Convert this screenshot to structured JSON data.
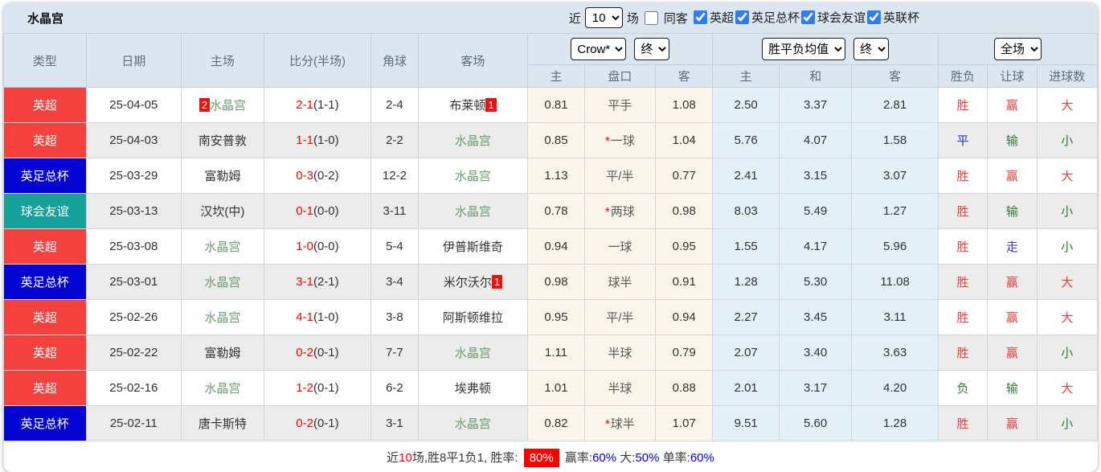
{
  "page": {
    "title": "水晶宫",
    "filters": {
      "near_label": "近",
      "near_value": "10",
      "games_label": "场",
      "same_opponent_label": "同客",
      "leagues": [
        {
          "label": "英超",
          "checked": true
        },
        {
          "label": "英足总杯",
          "checked": true
        },
        {
          "label": "球会友谊",
          "checked": true
        },
        {
          "label": "英联杯",
          "checked": true
        }
      ]
    }
  },
  "table": {
    "headers": {
      "main": [
        "类型",
        "日期",
        "主场",
        "比分(半场)",
        "角球",
        "客场"
      ],
      "sub": [
        "主",
        "盘口",
        "客",
        "主",
        "和",
        "客",
        "胜负",
        "让球",
        "进球数"
      ]
    },
    "selectors": {
      "bookmaker": "Crow*",
      "handicap_time": "终",
      "avg_label": "胜平负均值",
      "avg_time": "终",
      "period": "全场"
    },
    "league_colors": {
      "英超": "#f5413d",
      "英足总杯": "#0503d1",
      "球会友谊": "#16a09a"
    },
    "rows": [
      {
        "league": {
          "label": "英超",
          "color": "#f5413d"
        },
        "date": "25-04-05",
        "home": {
          "name": "水晶宫",
          "subject": true,
          "badge": "2"
        },
        "score": {
          "full": "2-1",
          "half": "(1-1)"
        },
        "corners": "2-4",
        "away": {
          "name": "布莱顿",
          "subject": false,
          "badge": "1"
        },
        "handicap": {
          "home": "0.81",
          "star": false,
          "line": "平手",
          "away": "1.08"
        },
        "avg": {
          "home": "2.50",
          "draw": "3.37",
          "away": "2.81"
        },
        "result": {
          "label": "胜",
          "tone": "red"
        },
        "let": {
          "label": "赢",
          "tone": "red"
        },
        "goals": {
          "label": "大",
          "tone": "red"
        }
      },
      {
        "league": {
          "label": "英超",
          "color": "#f5413d"
        },
        "date": "25-04-03",
        "home": {
          "name": "南安普敦",
          "subject": false,
          "badge": ""
        },
        "score": {
          "full": "1-1",
          "half": "(1-0)"
        },
        "corners": "2-2",
        "away": {
          "name": "水晶宫",
          "subject": true,
          "badge": ""
        },
        "handicap": {
          "home": "0.85",
          "star": true,
          "line": "一球",
          "away": "1.04"
        },
        "avg": {
          "home": "5.76",
          "draw": "4.07",
          "away": "1.58"
        },
        "result": {
          "label": "平",
          "tone": "blue"
        },
        "let": {
          "label": "输",
          "tone": "green"
        },
        "goals": {
          "label": "小",
          "tone": "green"
        }
      },
      {
        "league": {
          "label": "英足总杯",
          "color": "#0503d1"
        },
        "date": "25-03-29",
        "home": {
          "name": "富勒姆",
          "subject": false,
          "badge": ""
        },
        "score": {
          "full": "0-3",
          "half": "(0-2)"
        },
        "corners": "12-2",
        "away": {
          "name": "水晶宫",
          "subject": true,
          "badge": ""
        },
        "handicap": {
          "home": "1.13",
          "star": false,
          "line": "平/半",
          "away": "0.77"
        },
        "avg": {
          "home": "2.41",
          "draw": "3.15",
          "away": "3.07"
        },
        "result": {
          "label": "胜",
          "tone": "red"
        },
        "let": {
          "label": "赢",
          "tone": "red"
        },
        "goals": {
          "label": "大",
          "tone": "red"
        }
      },
      {
        "league": {
          "label": "球会友谊",
          "color": "#16a09a"
        },
        "date": "25-03-13",
        "home": {
          "name": "汉坎(中)",
          "subject": false,
          "badge": ""
        },
        "score": {
          "full": "0-1",
          "half": "(0-0)"
        },
        "corners": "3-11",
        "away": {
          "name": "水晶宫",
          "subject": true,
          "badge": ""
        },
        "handicap": {
          "home": "0.78",
          "star": true,
          "line": "两球",
          "away": "0.98"
        },
        "avg": {
          "home": "8.03",
          "draw": "5.49",
          "away": "1.27"
        },
        "result": {
          "label": "胜",
          "tone": "red"
        },
        "let": {
          "label": "输",
          "tone": "green"
        },
        "goals": {
          "label": "小",
          "tone": "green"
        }
      },
      {
        "league": {
          "label": "英超",
          "color": "#f5413d"
        },
        "date": "25-03-08",
        "home": {
          "name": "水晶宫",
          "subject": true,
          "badge": ""
        },
        "score": {
          "full": "1-0",
          "half": "(0-0)"
        },
        "corners": "5-4",
        "away": {
          "name": "伊普斯维奇",
          "subject": false,
          "badge": ""
        },
        "handicap": {
          "home": "0.94",
          "star": false,
          "line": "一球",
          "away": "0.95"
        },
        "avg": {
          "home": "1.55",
          "draw": "4.17",
          "away": "5.96"
        },
        "result": {
          "label": "胜",
          "tone": "red"
        },
        "let": {
          "label": "走",
          "tone": "blue"
        },
        "goals": {
          "label": "小",
          "tone": "green"
        }
      },
      {
        "league": {
          "label": "英足总杯",
          "color": "#0503d1"
        },
        "date": "25-03-01",
        "home": {
          "name": "水晶宫",
          "subject": true,
          "badge": ""
        },
        "score": {
          "full": "3-1",
          "half": "(2-1)"
        },
        "corners": "3-4",
        "away": {
          "name": "米尔沃尔",
          "subject": false,
          "badge": "1"
        },
        "handicap": {
          "home": "0.98",
          "star": false,
          "line": "球半",
          "away": "0.91"
        },
        "avg": {
          "home": "1.28",
          "draw": "5.30",
          "away": "11.08"
        },
        "result": {
          "label": "胜",
          "tone": "red"
        },
        "let": {
          "label": "赢",
          "tone": "red"
        },
        "goals": {
          "label": "大",
          "tone": "red"
        }
      },
      {
        "league": {
          "label": "英超",
          "color": "#f5413d"
        },
        "date": "25-02-26",
        "home": {
          "name": "水晶宫",
          "subject": true,
          "badge": ""
        },
        "score": {
          "full": "4-1",
          "half": "(1-0)"
        },
        "corners": "3-8",
        "away": {
          "name": "阿斯顿维拉",
          "subject": false,
          "badge": ""
        },
        "handicap": {
          "home": "0.95",
          "star": false,
          "line": "平/半",
          "away": "0.94"
        },
        "avg": {
          "home": "2.27",
          "draw": "3.45",
          "away": "3.11"
        },
        "result": {
          "label": "胜",
          "tone": "red"
        },
        "let": {
          "label": "赢",
          "tone": "red"
        },
        "goals": {
          "label": "大",
          "tone": "red"
        }
      },
      {
        "league": {
          "label": "英超",
          "color": "#f5413d"
        },
        "date": "25-02-22",
        "home": {
          "name": "富勒姆",
          "subject": false,
          "badge": ""
        },
        "score": {
          "full": "0-2",
          "half": "(0-1)"
        },
        "corners": "7-7",
        "away": {
          "name": "水晶宫",
          "subject": true,
          "badge": ""
        },
        "handicap": {
          "home": "1.11",
          "star": false,
          "line": "半球",
          "away": "0.79"
        },
        "avg": {
          "home": "2.07",
          "draw": "3.40",
          "away": "3.63"
        },
        "result": {
          "label": "胜",
          "tone": "red"
        },
        "let": {
          "label": "赢",
          "tone": "red"
        },
        "goals": {
          "label": "小",
          "tone": "green"
        }
      },
      {
        "league": {
          "label": "英超",
          "color": "#f5413d"
        },
        "date": "25-02-16",
        "home": {
          "name": "水晶宫",
          "subject": true,
          "badge": ""
        },
        "score": {
          "full": "1-2",
          "half": "(0-1)"
        },
        "corners": "6-2",
        "away": {
          "name": "埃弗顿",
          "subject": false,
          "badge": ""
        },
        "handicap": {
          "home": "1.01",
          "star": false,
          "line": "半球",
          "away": "0.88"
        },
        "avg": {
          "home": "2.01",
          "draw": "3.17",
          "away": "4.20"
        },
        "result": {
          "label": "负",
          "tone": "green"
        },
        "let": {
          "label": "输",
          "tone": "green"
        },
        "goals": {
          "label": "大",
          "tone": "red"
        }
      },
      {
        "league": {
          "label": "英足总杯",
          "color": "#0503d1"
        },
        "date": "25-02-11",
        "home": {
          "name": "唐卡斯特",
          "subject": false,
          "badge": ""
        },
        "score": {
          "full": "0-2",
          "half": "(0-1)"
        },
        "corners": "3-1",
        "away": {
          "name": "水晶宫",
          "subject": true,
          "badge": ""
        },
        "handicap": {
          "home": "0.82",
          "star": true,
          "line": "球半",
          "away": "1.07"
        },
        "avg": {
          "home": "9.51",
          "draw": "5.60",
          "away": "1.28"
        },
        "result": {
          "label": "胜",
          "tone": "red"
        },
        "let": {
          "label": "赢",
          "tone": "red"
        },
        "goals": {
          "label": "小",
          "tone": "green"
        }
      }
    ]
  },
  "summary": {
    "segments": [
      {
        "text": "近",
        "tone": "dark"
      },
      {
        "text": "10",
        "tone": "red"
      },
      {
        "text": "场,胜8平1负1, 胜率: ",
        "tone": "dark"
      },
      {
        "text": "80%",
        "tone": "badge"
      },
      {
        "text": " 赢率:",
        "tone": "dark"
      },
      {
        "text": "60%",
        "tone": "blue"
      },
      {
        "text": " 大:",
        "tone": "dark"
      },
      {
        "text": "50%",
        "tone": "blue"
      },
      {
        "text": " 单率:",
        "tone": "dark"
      },
      {
        "text": "60%",
        "tone": "blue"
      }
    ]
  }
}
